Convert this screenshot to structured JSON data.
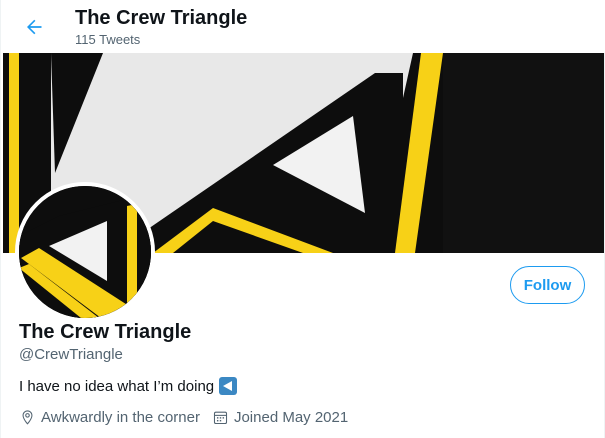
{
  "header": {
    "title": "The Crew Triangle",
    "tweet_count": "115 Tweets"
  },
  "profile": {
    "name": "The Crew Triangle",
    "handle": "@CrewTriangle",
    "bio": "I have no idea what I’m doing",
    "bio_emoji": "left-arrow-emoji",
    "location": "Awkwardly in the corner",
    "joined": "Joined May 2021",
    "follow_label": "Follow"
  },
  "colors": {
    "accent": "#1d9bf0",
    "secondary_text": "#536471",
    "banner_yellow": "#f7d117",
    "banner_black": "#0d0d0d"
  },
  "icons": {
    "back": "arrow-left-icon",
    "location": "location-pin-icon",
    "joined": "calendar-icon"
  }
}
